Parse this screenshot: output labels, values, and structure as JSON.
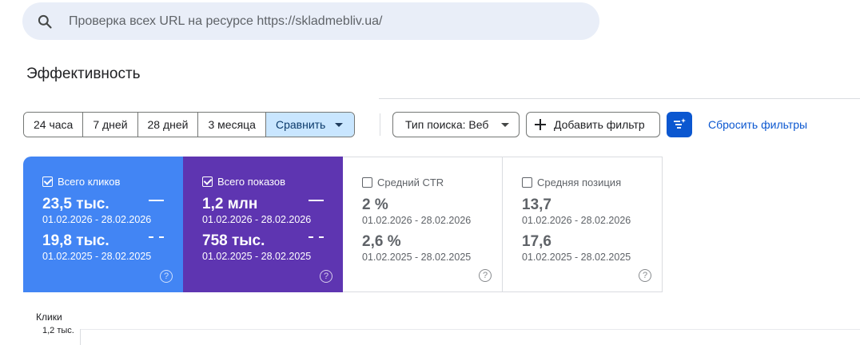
{
  "search": {
    "placeholder": "Проверка всех URL на ресурсе https://skladmebliv.ua/"
  },
  "page": {
    "title": "Эффективность"
  },
  "date_ranges": [
    {
      "label": "24 часа"
    },
    {
      "label": "7 дней"
    },
    {
      "label": "28 дней"
    },
    {
      "label": "3 месяца"
    }
  ],
  "compare": {
    "label": "Сравнить"
  },
  "filters": {
    "search_type": "Тип поиска: Веб",
    "add_filter": "Добавить фильтр",
    "reset": "Сбросить фильтры"
  },
  "metrics": [
    {
      "label": "Всего кликов",
      "checked": true,
      "current_value": "23,5 тыс.",
      "current_period": "01.02.2026 - 28.02.2026",
      "previous_value": "19,8 тыс.",
      "previous_period": "01.02.2025 - 28.02.2025",
      "color": "#4285f4"
    },
    {
      "label": "Всего показов",
      "checked": true,
      "current_value": "1,2 млн",
      "current_period": "01.02.2026 - 28.02.2026",
      "previous_value": "758 тыс.",
      "previous_period": "01.02.2025 - 28.02.2025",
      "color": "#5e35b1"
    },
    {
      "label": "Средний CTR",
      "checked": false,
      "current_value": "2 %",
      "current_period": "01.02.2026 - 28.02.2026",
      "previous_value": "2,6 %",
      "previous_period": "01.02.2025 - 28.02.2025"
    },
    {
      "label": "Средняя позиция",
      "checked": false,
      "current_value": "13,7",
      "current_period": "01.02.2026 - 28.02.2026",
      "previous_value": "17,6",
      "previous_period": "01.02.2025 - 28.02.2025"
    }
  ],
  "chart": {
    "ylabel": "Клики",
    "top_tick": "1,2 тыс."
  },
  "help_glyph": "?",
  "colors": {
    "accent": "#0b57d0",
    "compare_bg": "#c9e6ff",
    "search_bg": "#e9eef8"
  }
}
